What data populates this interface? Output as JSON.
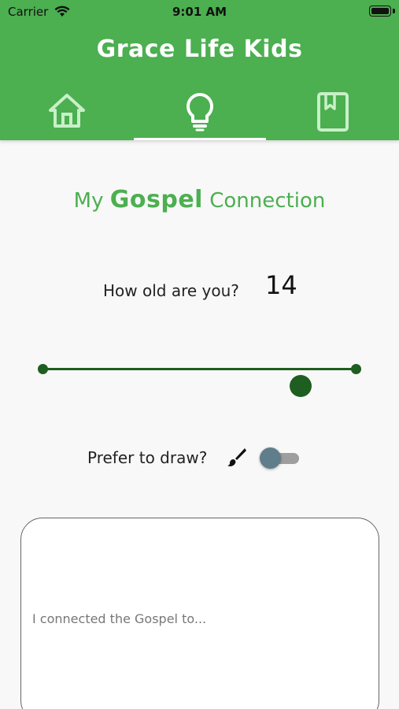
{
  "status_bar": {
    "carrier": "Carrier",
    "time": "9:01 AM"
  },
  "header": {
    "title": "Grace Life Kids",
    "tabs": [
      {
        "icon": "home-icon",
        "selected": false
      },
      {
        "icon": "lightbulb-icon",
        "selected": true
      },
      {
        "icon": "bookmark-book-icon",
        "selected": false
      }
    ]
  },
  "content": {
    "title_prefix": "My",
    "title_bold": "Gospel",
    "title_suffix": "Connection"
  },
  "age": {
    "label": "How old are you?",
    "value": "14",
    "slider_fraction": 0.82
  },
  "draw": {
    "label": "Prefer to draw?",
    "icon": "paintbrush-icon",
    "toggle_on": false
  },
  "entry": {
    "placeholder": "I connected the Gospel to...",
    "value": ""
  },
  "colors": {
    "brand_green": "#4caf50",
    "slider_green": "#1e5e20",
    "toggle_knob": "#607d8b",
    "tab_icon": "#c8f0c8"
  }
}
